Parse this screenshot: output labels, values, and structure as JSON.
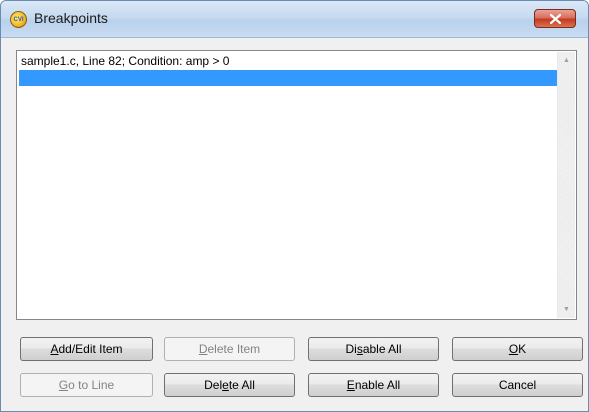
{
  "window": {
    "title": "Breakpoints",
    "icon": "cvi-app-icon",
    "icon_text": "CVI"
  },
  "breakpoints": {
    "items": [
      {
        "text": "sample1.c, Line 82;  Condition: amp > 0",
        "selected": false
      },
      {
        "text": "",
        "selected": true
      }
    ]
  },
  "buttons": {
    "add_edit": {
      "pre": "",
      "key": "A",
      "post": "dd/Edit Item",
      "enabled": true
    },
    "delete_item": {
      "pre": "",
      "key": "D",
      "post": "elete Item",
      "enabled": false
    },
    "disable_all": {
      "pre": "Di",
      "key": "s",
      "post": "able All",
      "enabled": true
    },
    "ok": {
      "pre": "",
      "key": "O",
      "post": "K",
      "enabled": true
    },
    "go_to_line": {
      "pre": "",
      "key": "G",
      "post": "o to Line",
      "enabled": false
    },
    "delete_all": {
      "pre": "Del",
      "key": "e",
      "post": "te All",
      "enabled": true
    },
    "enable_all": {
      "pre": "",
      "key": "E",
      "post": "nable All",
      "enabled": true
    },
    "cancel": {
      "pre": "Cancel",
      "key": "",
      "post": "",
      "enabled": true
    }
  },
  "colors": {
    "selection": "#3399ff",
    "close_button": "#c43a21"
  }
}
